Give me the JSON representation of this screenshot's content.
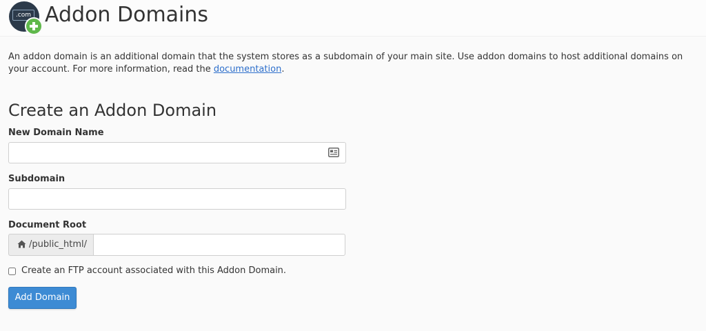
{
  "header": {
    "icon_text": ".com",
    "title": "Addon Domains"
  },
  "intro": {
    "text": "An addon domain is an additional domain that the system stores as a subdomain of your main site. Use addon domains to host additional domains on your account. For more information, read the ",
    "link_text": "documentation",
    "suffix": "."
  },
  "form": {
    "title": "Create an Addon Domain",
    "new_domain": {
      "label": "New Domain Name",
      "value": "",
      "icon": "id-card-icon"
    },
    "subdomain": {
      "label": "Subdomain",
      "value": ""
    },
    "document_root": {
      "label": "Document Root",
      "prefix": "/public_html/",
      "prefix_icon": "home-icon",
      "value": ""
    },
    "ftp": {
      "label": "Create an FTP account associated with this Addon Domain.",
      "checked": false
    },
    "submit_label": "Add Domain"
  },
  "colors": {
    "primary_button": "#3d8bd4",
    "link": "#2c6ecb",
    "icon_badge": "#5fb84b",
    "icon_bg": "#2c3a4a"
  }
}
